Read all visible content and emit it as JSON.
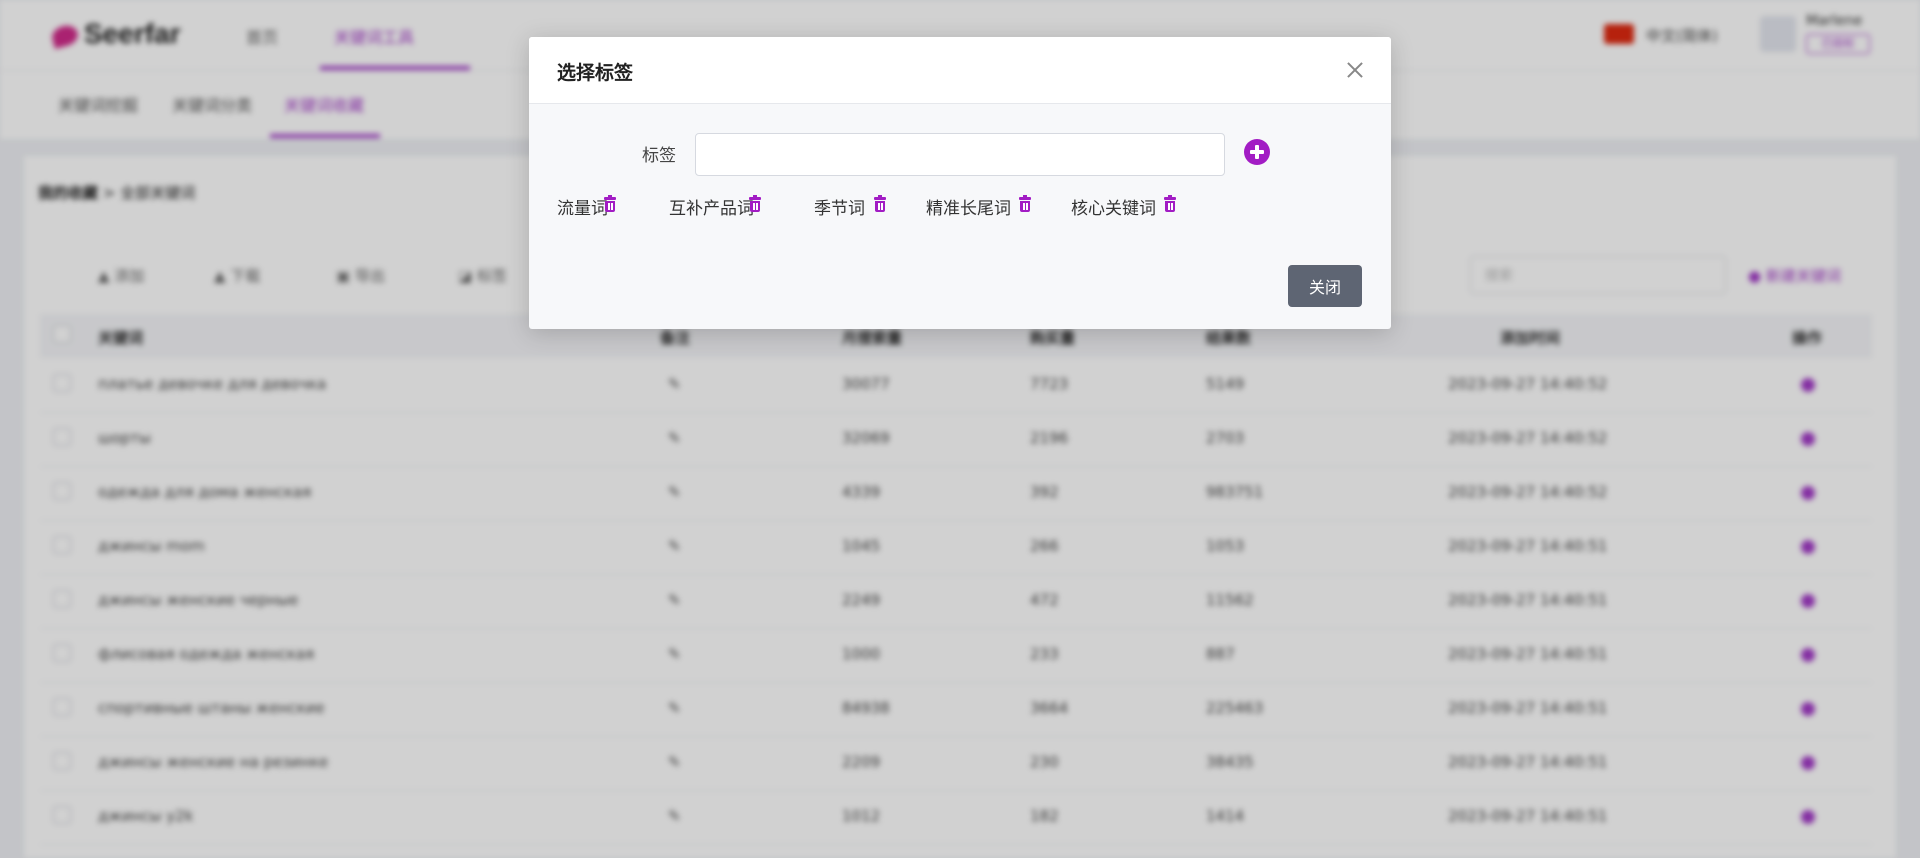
{
  "background_app": {
    "logo": "Seerfar",
    "top_nav": [
      "首页",
      "关键词工具"
    ],
    "language": "中文(简体)",
    "user": {
      "name": "Marlene",
      "badge": "已授权"
    },
    "sub_nav": [
      "关键词挖掘",
      "关键词分类",
      "关键词收藏"
    ],
    "breadcrumb": {
      "root": "我的收藏",
      "current": "全部关键词"
    },
    "toolbar": [
      "添加",
      "下载",
      "导出",
      "标签"
    ],
    "search_placeholder": "搜索",
    "create_button": "新建关键词",
    "table": {
      "headers": [
        "关键词",
        "备注",
        "月搜索量",
        "购买量",
        "结果数",
        "添加时间",
        "操作"
      ],
      "rows": [
        [
          "платье девочке для девочка",
          "30077",
          "7723",
          "5149",
          "2023-09-27 14:40:52"
        ],
        [
          "шорты",
          "32069",
          "2196",
          "2703",
          "2023-09-27 14:40:52"
        ],
        [
          "одежда для дома женская",
          "4339",
          "392",
          "983751",
          "2023-09-27 14:40:52"
        ],
        [
          "джинсы mom",
          "1045",
          "266",
          "1053",
          "2023-09-27 14:40:51"
        ],
        [
          "джинсы женские черные",
          "2249",
          "472",
          "11562",
          "2023-09-27 14:40:51"
        ],
        [
          "флисовая одежда женская",
          "1000",
          "233",
          "887",
          "2023-09-27 14:40:51"
        ],
        [
          "спортивные штаны женские",
          "84938",
          "3664",
          "225463",
          "2023-09-27 14:40:51"
        ],
        [
          "джинсы женские на резинке",
          "2209",
          "230",
          "38435",
          "2023-09-27 14:40:51"
        ],
        [
          "джинсы y2k",
          "1012",
          "182",
          "1414",
          "2023-09-27 14:40:51"
        ]
      ]
    }
  },
  "modal": {
    "title": "选择标签",
    "label": "标签",
    "input_value": "",
    "tags": [
      "流量词",
      "互补产品词",
      "季节词",
      "精准长尾词",
      "核心关键词"
    ],
    "close_button": "关闭"
  },
  "colors": {
    "accent": "#a21cc4",
    "close_button": "#5e6573"
  },
  "icons": [
    "close-icon",
    "plus-circle-icon",
    "trash-icon"
  ]
}
